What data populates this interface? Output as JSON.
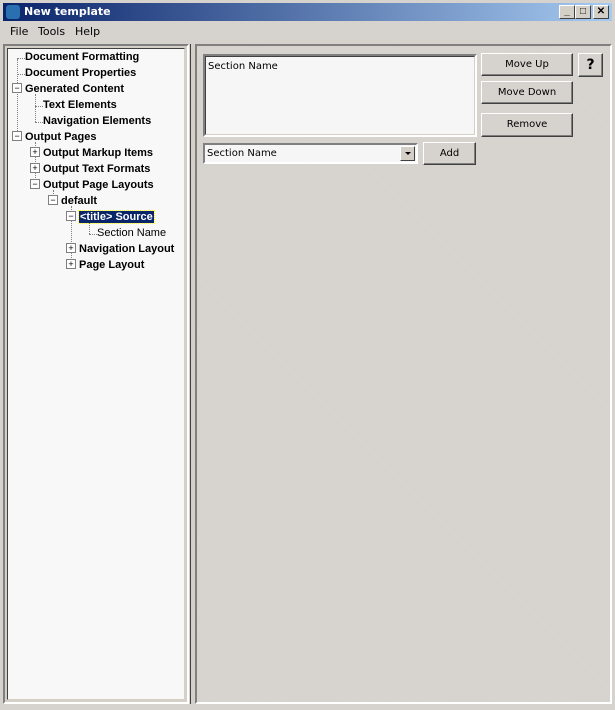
{
  "window": {
    "title": "New template"
  },
  "menu": {
    "items": [
      "File",
      "Tools",
      "Help"
    ]
  },
  "title_buttons": {
    "minimize": "_",
    "maximize": "□",
    "close": "✕"
  },
  "tree": {
    "nodes": [
      {
        "label": "Document Formatting"
      },
      {
        "label": "Document Properties"
      },
      {
        "label": "Generated Content",
        "expanded": true
      },
      {
        "label": "Text Elements"
      },
      {
        "label": "Navigation Elements"
      },
      {
        "label": "Output Pages",
        "expanded": true
      },
      {
        "label": "Output Markup Items",
        "expanded": false
      },
      {
        "label": "Output Text Formats",
        "expanded": false
      },
      {
        "label": "Output Page Layouts",
        "expanded": true
      },
      {
        "label": "default",
        "expanded": true
      },
      {
        "label": "<title> Source",
        "expanded": true,
        "selected": true
      },
      {
        "label": "Section Name"
      },
      {
        "label": "Navigation Layout",
        "expanded": false
      },
      {
        "label": "Page Layout",
        "expanded": false
      }
    ]
  },
  "editor": {
    "list_items": [
      "Section Name"
    ],
    "combo_value": "Section Name",
    "add_label": "Add",
    "move_up_label": "Move Up",
    "move_down_label": "Move Down",
    "remove_label": "Remove",
    "help_label": "?"
  }
}
